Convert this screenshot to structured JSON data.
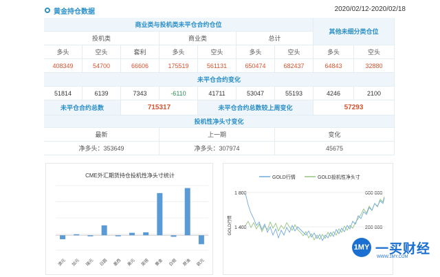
{
  "header": {
    "title": "黄金持仓数据",
    "daterange": "2020/02/12-2020/02/18"
  },
  "table": {
    "group1_title": "商业类与投机类未平仓合约仓位",
    "group2_title": "其他未细分类仓位",
    "sub_spec": "投机类",
    "sub_comm": "商业类",
    "sub_total": "总计",
    "h_long": "多头",
    "h_short": "空头",
    "h_spread": "套利",
    "values": [
      "408349",
      "54700",
      "66606",
      "175519",
      "561131",
      "650474",
      "682437",
      "64843",
      "32880"
    ],
    "change_title": "未平仓合约变化",
    "changes": [
      "51814",
      "6139",
      "7343",
      "-6110",
      "41711",
      "53047",
      "55193",
      "4246",
      "2100"
    ],
    "oi_total_label": "未平仓合约总数",
    "oi_total_value": "715317",
    "oi_change_label": "未平仓合约总数较上周变化",
    "oi_change_value": "57293",
    "net_title": "投机性净头寸变化",
    "net_h_latest": "最新",
    "net_h_prev": "上一期",
    "net_h_change": "变化",
    "net_latest": "净多头：353649",
    "net_prev": "净多头：307974",
    "net_change": "45675"
  },
  "chart_data": [
    {
      "type": "bar",
      "title": "CME外汇期货持仓投机性净头寸统计",
      "categories": [
        "澳元",
        "加元",
        "瑞元",
        "日圆",
        "墨西",
        "美元",
        "英镑",
        "黄金",
        "白银",
        "原油",
        "欧元"
      ],
      "values": [
        -8,
        2,
        -2,
        20,
        0,
        5,
        6,
        85,
        -3,
        95,
        -18
      ],
      "ylim": [
        -30,
        100
      ],
      "color": "#5b9bd5"
    },
    {
      "type": "line",
      "legend": [
        "GOLD行情",
        "GOLD投机性净头寸"
      ],
      "ylabel_left": "GOLD行情",
      "yticks_left": [
        "1 800",
        "1 400"
      ],
      "yticks_right": [
        "600 000",
        "200 000"
      ],
      "colors": [
        "#6fa8dc",
        "#93c47d"
      ]
    }
  ],
  "brand": {
    "logo": "1MY",
    "name": "一买财经",
    "url": "WWW.1MY.COM"
  }
}
